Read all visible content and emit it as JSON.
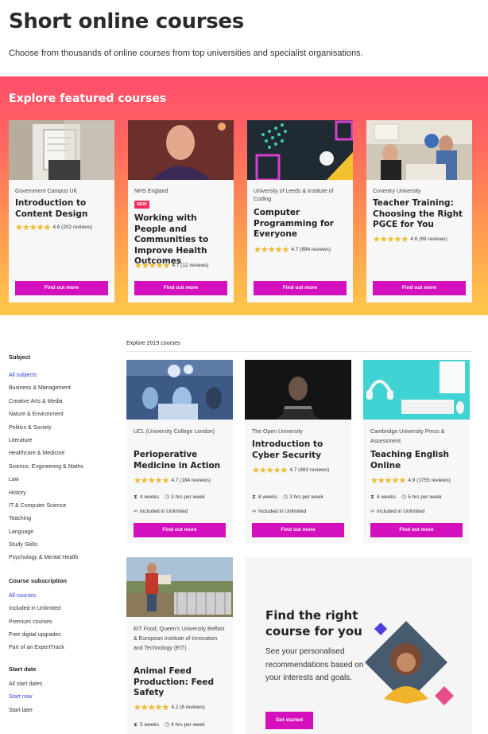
{
  "page": {
    "title": "Short online courses",
    "subtitle": "Choose from thousands of online courses from top universities and specialist organisations."
  },
  "featured": {
    "title": "Explore featured courses",
    "cards": [
      {
        "org": "Government Campus UK",
        "title": "Introduction to Content Design",
        "rating": "4.6 (202 reviews)",
        "button": "Find out more"
      },
      {
        "org": "NHS England",
        "badge": "NEW",
        "title": "Working with People and Communities to Improve Health Outcomes",
        "rating": "4.7 (12 reviews)",
        "button": "Find out more"
      },
      {
        "org": "University of Leeds & Institute of Coding",
        "title": "Computer Programming for Everyone",
        "rating": "4.7 (894 reviews)",
        "button": "Find out more"
      },
      {
        "org": "Coventry University",
        "title": "Teacher Training: Choosing the Right PGCE for You",
        "rating": "4.6 (69 reviews)",
        "button": "Find out more"
      }
    ]
  },
  "sidebar": {
    "subject": {
      "heading": "Subject",
      "items": [
        "All subjects",
        "Business & Management",
        "Creative Arts & Media",
        "Nature & Environment",
        "Politics & Society",
        "Literature",
        "Healthcare & Medicine",
        "Science, Engineering & Maths",
        "Law",
        "History",
        "IT & Computer Science",
        "Teaching",
        "Language",
        "Study Skills",
        "Psychology & Mental Health"
      ]
    },
    "subscription": {
      "heading": "Course subscription",
      "items": [
        "All courses",
        "Included in Unlimited",
        "Premium courses",
        "Free digital upgrades",
        "Part of an ExpertTrack"
      ]
    },
    "start_date": {
      "heading": "Start date",
      "items": [
        "All start dates",
        "Start now",
        "Start later"
      ]
    }
  },
  "courses": {
    "label": "Explore 2019 courses",
    "cards": [
      {
        "org": "UCL (University College London)",
        "title": "Perioperative Medicine in Action",
        "rating": "4.7 (184 reviews)",
        "weeks": "4 weeks",
        "hours": "3 hrs per week",
        "unlimited": "Included in Unlimited",
        "button": "Find out more"
      },
      {
        "org": "The Open University",
        "title": "Introduction to Cyber Security",
        "rating": "4.7 (483 reviews)",
        "weeks": "8 weeks",
        "hours": "3 hrs per week",
        "unlimited": "Included in Unlimited",
        "button": "Find out more"
      },
      {
        "org": "Cambridge University Press & Assessment",
        "title": "Teaching English Online",
        "rating": "4.9 (1755 reviews)",
        "weeks": "4 weeks",
        "hours": "5 hrs per week",
        "unlimited": "Included in Unlimited",
        "button": "Find out more"
      },
      {
        "org": "EIT Food, Queen's University Belfast & European Institute of Innovation and Technology (EIT)",
        "title": "Animal Feed Production: Feed Safety",
        "rating": "4.2 (6 reviews)",
        "weeks": "5 weeks",
        "hours": "4 hrs per week"
      }
    ]
  },
  "promo": {
    "title": "Find the right course for you",
    "text": "See your personalised recommendations based on your interests and goals.",
    "button": "Get started"
  },
  "colors": {
    "accent": "#d40fbd",
    "link": "#2a3ed6",
    "star": "#f0b92e",
    "badge": "#ff2a5c"
  }
}
